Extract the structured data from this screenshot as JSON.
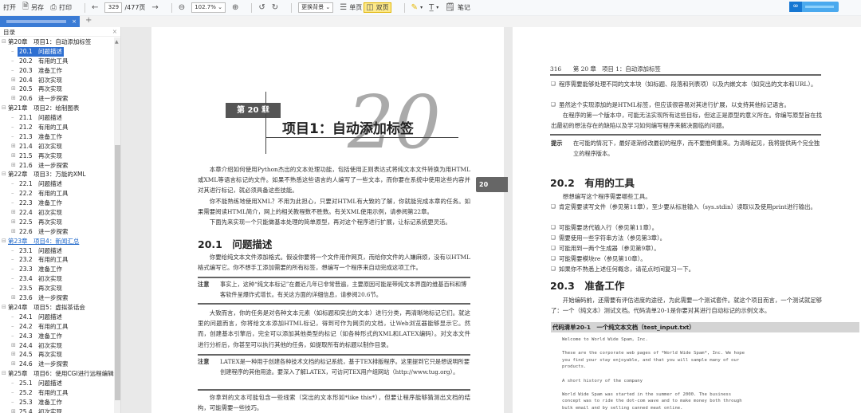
{
  "toolbar": {
    "open": "打开",
    "save_as": "另存",
    "print": "打印",
    "page_current": "329",
    "page_total": "/477页",
    "zoom": "102.7%",
    "background": "更换背景",
    "single_page": "单页",
    "double_page": "双页",
    "note": "笔记"
  },
  "sidebar": {
    "title": "目录",
    "chapters": [
      {
        "label": "第20章　项目1：自动添加标签",
        "items": [
          [
            "20.1",
            "问题描述",
            0
          ],
          [
            "20.2",
            "有用的工具",
            0
          ],
          [
            "20.3",
            "准备工作",
            0
          ],
          [
            "20.4",
            "初次实现",
            1
          ],
          [
            "20.5",
            "再次实现",
            1
          ],
          [
            "20.6",
            "进一步探索",
            1
          ]
        ]
      },
      {
        "label": "第21章　项目2：绘制图表",
        "items": [
          [
            "21.1",
            "问题描述",
            0
          ],
          [
            "21.2",
            "有用的工具",
            0
          ],
          [
            "21.3",
            "准备工作",
            0
          ],
          [
            "21.4",
            "初次实现",
            1
          ],
          [
            "21.5",
            "再次实现",
            1
          ],
          [
            "21.6",
            "进一步探索",
            1
          ]
        ]
      },
      {
        "label": "第22章　项目3：万能的XML",
        "items": [
          [
            "22.1",
            "问题描述",
            0
          ],
          [
            "22.2",
            "有用的工具",
            0
          ],
          [
            "22.3",
            "准备工作",
            0
          ],
          [
            "22.4",
            "初次实现",
            1
          ],
          [
            "22.5",
            "再次实现",
            1
          ],
          [
            "22.6",
            "进一步探索",
            1
          ]
        ]
      },
      {
        "label": "第23章　项目4：新闻汇总",
        "items": [
          [
            "23.1",
            "问题描述",
            0
          ],
          [
            "23.2",
            "有用的工具",
            0
          ],
          [
            "23.3",
            "准备工作",
            0
          ],
          [
            "23.4",
            "初次实现",
            0
          ],
          [
            "23.5",
            "再次实现",
            0
          ],
          [
            "23.6",
            "进一步探索",
            1
          ]
        ]
      },
      {
        "label": "第24章　项目5：虚拟茶话会",
        "items": [
          [
            "24.1",
            "问题描述",
            0
          ],
          [
            "24.2",
            "有用的工具",
            0
          ],
          [
            "24.3",
            "准备工作",
            0
          ],
          [
            "24.4",
            "初次实现",
            1
          ],
          [
            "24.5",
            "再次实现",
            1
          ],
          [
            "24.6",
            "进一步探索",
            1
          ]
        ]
      },
      {
        "label": "第25章　项目6：使用CGI进行远程编辑",
        "items": [
          [
            "25.1",
            "问题描述",
            0
          ],
          [
            "25.2",
            "有用的工具",
            0
          ],
          [
            "25.3",
            "准备工作",
            0
          ],
          [
            "25.4",
            "初次实现",
            1
          ]
        ]
      }
    ],
    "selected": "20.1",
    "hovered_chapter": "第23章　项目4：新闻汇总"
  },
  "left_page": {
    "chapter_label": "第 20 章",
    "chapter_number": "20",
    "chapter_title": "项目1：自动添加标签",
    "side_tab": "20",
    "intro": [
      "本章介绍如何使用Python杰出的文本处理功能，包括使用正则表达式将纯文本文件转换为用HTML或XML等语言标记的文件。如果不熟悉这些语言的人编写了一些文本，而你要在系统中使用这些内容并对其进行标记，就必须具备这些技能。",
      "你不能熟练地使用XML？不用为此担心，只要对HTML有大致的了解，你就能完成本章的任务。如果需要阅读HTML简介，网上的相关教程数不胜数。有关XML使用示例，请参阅第22章。",
      "下面先来实现一个只能做基本处理的简单原型，再对这个程序进行扩展，让标记系统更灵活。"
    ],
    "section": "20.1　问题描述",
    "p1": "你要给纯文本文件添加格式。假设你要将一个文件用作网页，而给你文件的人嫌麻烦，没有以HTML格式编写它。你不想手工添加需要的所有标签，想编写一个程序来自动完成这项工作。",
    "note1_label": "注意",
    "note1": "事实上，这种“纯文本标记”在最近几年已非常普遍，主要原因可能是带纯文本界面的维基百科和博客软件呈爆炸式增长。有关这方面的详细信息，请参阅20.6节。",
    "p2": "大致而言，你的任务是对各种文本元素（如标题和突出的文本）进行分类，再清晰地标记它们。就这里的问题而言，你将给文本添加HTML标记，得到可作为网页的文档，让Web浏览器能够显示它。然而，创建基本引擎后，完全可以添加其他类型的标记（如各种形式的XML和LATEX编码）。对文本文件进行分析后，你甚至可以执行其他的任务，如提取所有的标题以制作目录。",
    "note2_label": "注意",
    "note2": "LATEX是一种用于创建各种技术文档的标记系统，基于TEX排版程序。这里提到它只是想说明所要创建程序的其他用途。要深入了解LATEX，可访问TEX用户组网站（http://www.tug.org）。",
    "p3": "你拿到的文本可能包含一些线索（突出的文本形如*like this*），但要让程序能够猜测出文档的结构，可能需要一些技巧。"
  },
  "right_page": {
    "running_head": "316　　第 20 章　项目 1：自动添加标签",
    "bullets_top": [
      "程序需要能够处理不同的文本块（如标题、段落和列表项）以及内嵌文本（如突出的文本和URL）。",
      "虽然这个实现添加的是HTML标签，但应该很容易对其进行扩展，以支持其他标记语言。"
    ],
    "p_top": "在程序的第一个版本中，可能无法实现所有这些目标，但这正是原型的意义所在。你编写原型旨在找出最初的想法存在的缺陷以及学习如何编写程序来解决面临的问题。",
    "tip_label": "提示",
    "tip": "在可能的情况下，最好逐渐修改最初的程序，而不要推倒重来。为清晰起见，我将提供两个完全独立的程序版本。",
    "section2": "20.2　有用的工具",
    "p_tools": "想想编写这个程序需要哪些工具。",
    "tools": [
      "肯定需要读写文件（参见第11章），至少要从标准输入（sys.stdin）读取以及使用print进行输出。",
      "可能需要迭代输入行（参见第11章）。",
      "需要使用一些字符串方法（参见第3章）。",
      "可能用到一两个生成器（参见第9章）。",
      "可能需要模块re（参见第10章）。",
      "如果你不熟悉上述任何概念，请花点时间复习一下。"
    ],
    "section3": "20.3　准备工作",
    "p_prep": "开始编码前，还需要有评估进度的途径，为此需要一个测试套件。就这个项目而言，一个测试就足够了：一个（纯文本）测试文档。代码清单20-1是你要对其进行自动标记的示例文本。",
    "code_title": "代码清单20-1　一个纯文本文档（test_input.txt）",
    "code": [
      "Welcome to World Wide Spam, Inc.",
      "",
      "These are the corporate web pages of *World Wide Spam*, Inc. We hope",
      "you find your stay enjoyable, and that you will sample many of our",
      "products.",
      "",
      "A short history of the company",
      "",
      "World Wide Spam was started in the summer of 2000. The business",
      "concept was to ride the dot-com wave and to make money both through",
      "bulk email and by selling canned meat online."
    ]
  },
  "colors": {
    "accent": "#2e6fd1",
    "active_view": "#fde98a",
    "brand": "#1677d2"
  }
}
